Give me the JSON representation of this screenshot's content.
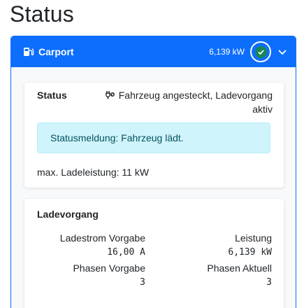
{
  "page": {
    "title": "Status"
  },
  "panel": {
    "icon": "ev-charger-icon",
    "title": "Carport",
    "power": "6,139 kW",
    "status_icon": "check-circle-icon",
    "status_color": "#198754",
    "accent_color": "#0d6efd",
    "toggle_icon": "chevron-down-icon"
  },
  "status_card": {
    "label": "Status",
    "value_icon": "plug-icon",
    "value": "Fahrzeug angesteckt, Ladevorgang aktiv",
    "alert": "Statusmeldung: Fahrzeug lädt.",
    "max_power": "max. Ladeleistung: 11 kW"
  },
  "charging_card": {
    "title": "Ladevorgang",
    "fields": [
      {
        "label": "Ladestrom Vorgabe",
        "value": "16,00 A"
      },
      {
        "label": "Leistung",
        "value": "6,139 kW"
      },
      {
        "label": "Phasen Vorgabe",
        "value": "3"
      },
      {
        "label": "Phasen Aktuell",
        "value": "3"
      }
    ]
  }
}
